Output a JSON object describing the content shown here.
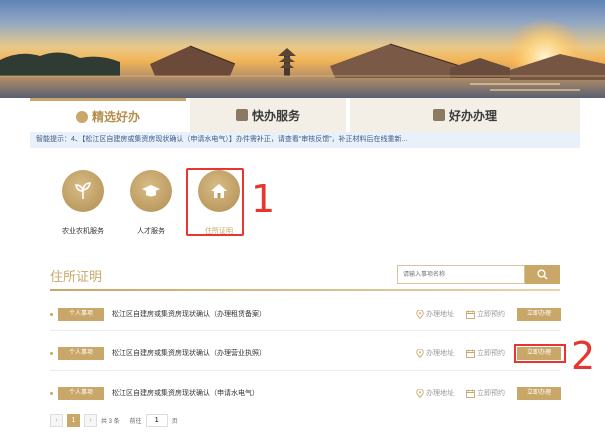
{
  "tabs": [
    {
      "label": "精选好办"
    },
    {
      "label": "快办服务"
    },
    {
      "label": "好办办理"
    }
  ],
  "notice": "智能提示：4、【松江区自建房或集资房现状确认（申请水电气）】办件需补正，请查看“审核反馈”，补正材料后在线重新...",
  "categories": [
    {
      "label": "农业农机服务",
      "icon": "sprout-icon"
    },
    {
      "label": "人才服务",
      "icon": "graduation-cap-icon"
    },
    {
      "label": "住所证明",
      "icon": "house-icon"
    }
  ],
  "section": {
    "title": "住所证明",
    "search_placeholder": "请输入事项名称"
  },
  "items": [
    {
      "badge": "个人事项",
      "title": "松江区自建房或集资房现状确认（办理租赁备案）",
      "addr": "办理地址",
      "appt": "立即预约",
      "go": "立即办理"
    },
    {
      "badge": "个人事项",
      "title": "松江区自建房或集资房现状确认（办理营业执照）",
      "addr": "办理地址",
      "appt": "立即预约",
      "go": "立即办理"
    },
    {
      "badge": "个人事项",
      "title": "松江区自建房或集资房现状确认（申请水电气）",
      "addr": "办理地址",
      "appt": "立即预约",
      "go": "立即办理"
    }
  ],
  "pagination": {
    "prev": "‹",
    "current": "1",
    "next": "›",
    "total": "共 3 条",
    "goto_label": "前往",
    "goto_value": "1",
    "page_unit": "页"
  },
  "annotations": {
    "first": "1",
    "second": "2"
  },
  "colors": {
    "accent": "#c9a769",
    "highlight": "#e8352f",
    "notice_bg": "#e8f0fa"
  }
}
